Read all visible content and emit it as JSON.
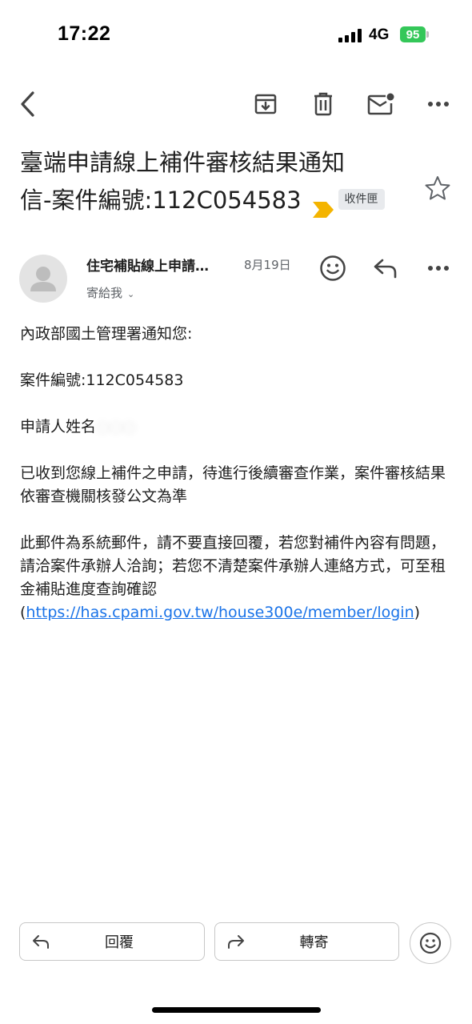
{
  "status_bar": {
    "time": "17:22",
    "network": "4G",
    "battery": "95"
  },
  "toolbar": {
    "back_icon": "back-arrow-icon",
    "archive_icon": "archive-icon",
    "delete_icon": "trash-icon",
    "mark_unread_icon": "mail-unread-icon",
    "more_icon": "more-horizontal-icon"
  },
  "email": {
    "subject_line1": "臺端申請線上補件審核結果通知",
    "subject_line2": "信-案件編號:112C054583",
    "label": "收件匣",
    "sender_name": "住宅補貼線上申請…",
    "date": "8月19日",
    "recipient": "寄給我",
    "body": {
      "greeting": "內政部國土管理署通知您:",
      "case_number": "案件編號:112C054583",
      "applicant_name": "申請人姓名",
      "applicant_value": "○○○",
      "paragraph1": "已收到您線上補件之申請，待進行後續審查作業，案件審核結果依審查機關核發公文為準",
      "paragraph2": "此郵件為系統郵件，請不要直接回覆，若您對補件內容有問題，請洽案件承辦人洽詢；若您不清楚案件承辦人連絡方式，可至租金補貼進度查詢確認",
      "link_open": "(",
      "link_text": "https://has.cpami.gov.tw/house300e/member/login",
      "link_close": ")"
    }
  },
  "actions": {
    "reply_label": "回覆",
    "forward_label": "轉寄"
  },
  "colors": {
    "link": "#1a73e8",
    "importance": "#f4b400",
    "battery": "#34c759"
  }
}
